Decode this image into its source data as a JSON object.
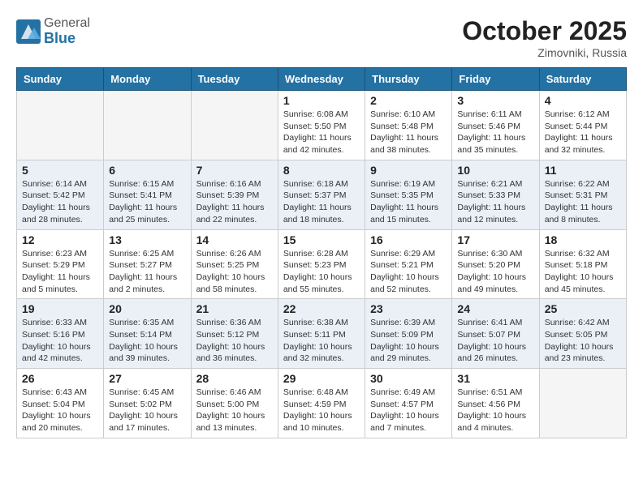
{
  "header": {
    "logo_line1": "General",
    "logo_line2": "Blue",
    "month": "October 2025",
    "location": "Zimovniki, Russia"
  },
  "weekdays": [
    "Sunday",
    "Monday",
    "Tuesday",
    "Wednesday",
    "Thursday",
    "Friday",
    "Saturday"
  ],
  "weeks": [
    [
      {
        "day": "",
        "info": ""
      },
      {
        "day": "",
        "info": ""
      },
      {
        "day": "",
        "info": ""
      },
      {
        "day": "1",
        "info": "Sunrise: 6:08 AM\nSunset: 5:50 PM\nDaylight: 11 hours and 42 minutes."
      },
      {
        "day": "2",
        "info": "Sunrise: 6:10 AM\nSunset: 5:48 PM\nDaylight: 11 hours and 38 minutes."
      },
      {
        "day": "3",
        "info": "Sunrise: 6:11 AM\nSunset: 5:46 PM\nDaylight: 11 hours and 35 minutes."
      },
      {
        "day": "4",
        "info": "Sunrise: 6:12 AM\nSunset: 5:44 PM\nDaylight: 11 hours and 32 minutes."
      }
    ],
    [
      {
        "day": "5",
        "info": "Sunrise: 6:14 AM\nSunset: 5:42 PM\nDaylight: 11 hours and 28 minutes."
      },
      {
        "day": "6",
        "info": "Sunrise: 6:15 AM\nSunset: 5:41 PM\nDaylight: 11 hours and 25 minutes."
      },
      {
        "day": "7",
        "info": "Sunrise: 6:16 AM\nSunset: 5:39 PM\nDaylight: 11 hours and 22 minutes."
      },
      {
        "day": "8",
        "info": "Sunrise: 6:18 AM\nSunset: 5:37 PM\nDaylight: 11 hours and 18 minutes."
      },
      {
        "day": "9",
        "info": "Sunrise: 6:19 AM\nSunset: 5:35 PM\nDaylight: 11 hours and 15 minutes."
      },
      {
        "day": "10",
        "info": "Sunrise: 6:21 AM\nSunset: 5:33 PM\nDaylight: 11 hours and 12 minutes."
      },
      {
        "day": "11",
        "info": "Sunrise: 6:22 AM\nSunset: 5:31 PM\nDaylight: 11 hours and 8 minutes."
      }
    ],
    [
      {
        "day": "12",
        "info": "Sunrise: 6:23 AM\nSunset: 5:29 PM\nDaylight: 11 hours and 5 minutes."
      },
      {
        "day": "13",
        "info": "Sunrise: 6:25 AM\nSunset: 5:27 PM\nDaylight: 11 hours and 2 minutes."
      },
      {
        "day": "14",
        "info": "Sunrise: 6:26 AM\nSunset: 5:25 PM\nDaylight: 10 hours and 58 minutes."
      },
      {
        "day": "15",
        "info": "Sunrise: 6:28 AM\nSunset: 5:23 PM\nDaylight: 10 hours and 55 minutes."
      },
      {
        "day": "16",
        "info": "Sunrise: 6:29 AM\nSunset: 5:21 PM\nDaylight: 10 hours and 52 minutes."
      },
      {
        "day": "17",
        "info": "Sunrise: 6:30 AM\nSunset: 5:20 PM\nDaylight: 10 hours and 49 minutes."
      },
      {
        "day": "18",
        "info": "Sunrise: 6:32 AM\nSunset: 5:18 PM\nDaylight: 10 hours and 45 minutes."
      }
    ],
    [
      {
        "day": "19",
        "info": "Sunrise: 6:33 AM\nSunset: 5:16 PM\nDaylight: 10 hours and 42 minutes."
      },
      {
        "day": "20",
        "info": "Sunrise: 6:35 AM\nSunset: 5:14 PM\nDaylight: 10 hours and 39 minutes."
      },
      {
        "day": "21",
        "info": "Sunrise: 6:36 AM\nSunset: 5:12 PM\nDaylight: 10 hours and 36 minutes."
      },
      {
        "day": "22",
        "info": "Sunrise: 6:38 AM\nSunset: 5:11 PM\nDaylight: 10 hours and 32 minutes."
      },
      {
        "day": "23",
        "info": "Sunrise: 6:39 AM\nSunset: 5:09 PM\nDaylight: 10 hours and 29 minutes."
      },
      {
        "day": "24",
        "info": "Sunrise: 6:41 AM\nSunset: 5:07 PM\nDaylight: 10 hours and 26 minutes."
      },
      {
        "day": "25",
        "info": "Sunrise: 6:42 AM\nSunset: 5:05 PM\nDaylight: 10 hours and 23 minutes."
      }
    ],
    [
      {
        "day": "26",
        "info": "Sunrise: 6:43 AM\nSunset: 5:04 PM\nDaylight: 10 hours and 20 minutes."
      },
      {
        "day": "27",
        "info": "Sunrise: 6:45 AM\nSunset: 5:02 PM\nDaylight: 10 hours and 17 minutes."
      },
      {
        "day": "28",
        "info": "Sunrise: 6:46 AM\nSunset: 5:00 PM\nDaylight: 10 hours and 13 minutes."
      },
      {
        "day": "29",
        "info": "Sunrise: 6:48 AM\nSunset: 4:59 PM\nDaylight: 10 hours and 10 minutes."
      },
      {
        "day": "30",
        "info": "Sunrise: 6:49 AM\nSunset: 4:57 PM\nDaylight: 10 hours and 7 minutes."
      },
      {
        "day": "31",
        "info": "Sunrise: 6:51 AM\nSunset: 4:56 PM\nDaylight: 10 hours and 4 minutes."
      },
      {
        "day": "",
        "info": ""
      }
    ]
  ]
}
